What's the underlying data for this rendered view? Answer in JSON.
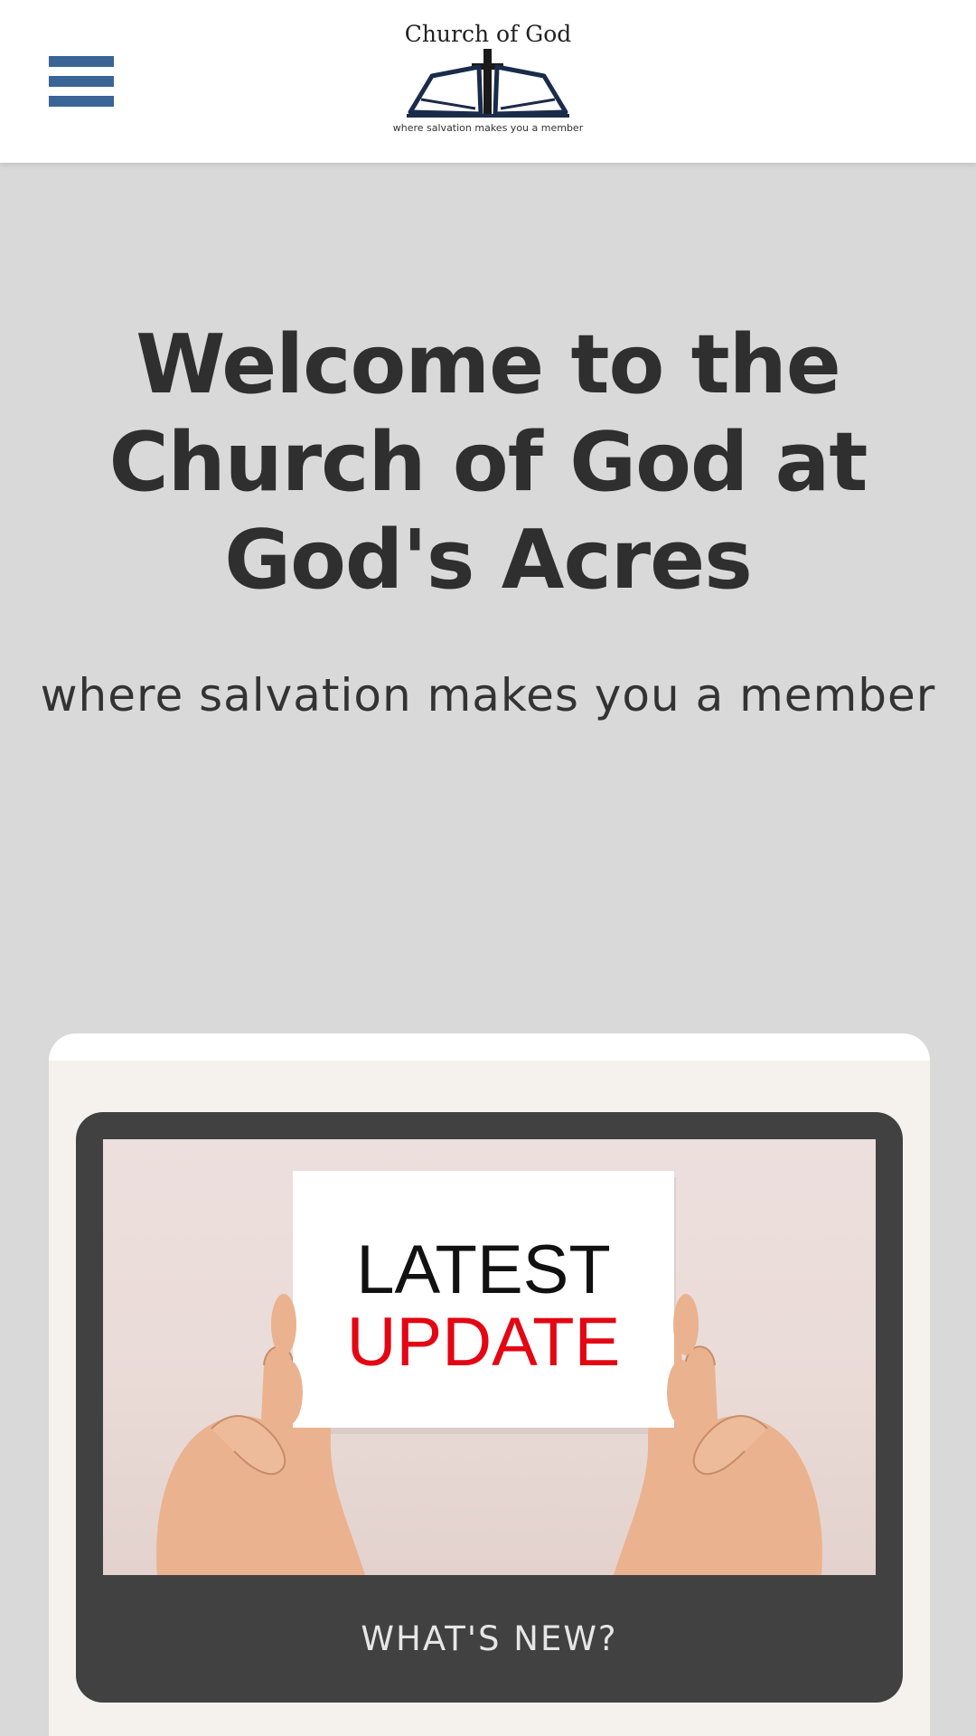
{
  "header": {
    "menu_icon": "hamburger-menu-icon",
    "menu_color": "#3a6496",
    "logo": {
      "title": "Church of God",
      "tagline": "where salvation makes you a member"
    }
  },
  "hero": {
    "title": "Welcome to the Church of God at God's Acres",
    "subtitle": "where salvation makes you a member"
  },
  "news": {
    "image_sign_line1": "LATEST",
    "image_sign_line2": "UPDATE",
    "sign_line2_color": "#e30613",
    "label": "WHAT'S NEW?"
  }
}
